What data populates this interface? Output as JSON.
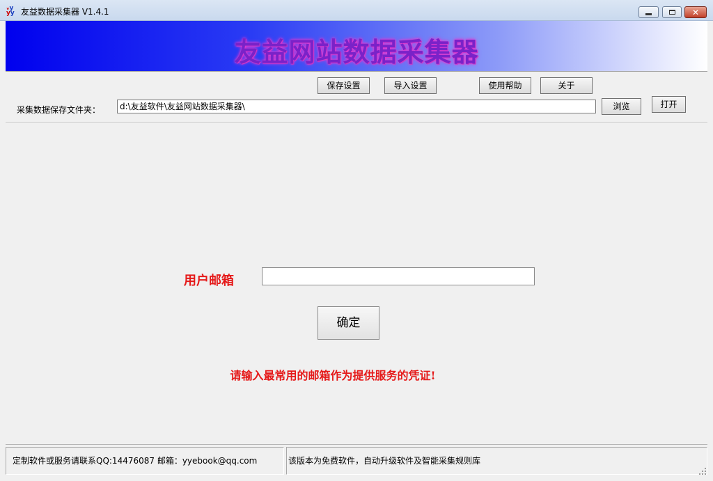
{
  "window": {
    "title": "友益数据采集器 V1.4.1",
    "icon": "app-logo-icon"
  },
  "banner": {
    "title": "友益网站数据采集器"
  },
  "toolbar": {
    "save_settings": "保存设置",
    "import_settings": "导入设置",
    "help": "使用帮助",
    "about": "关于"
  },
  "folder": {
    "label": "采集数据保存文件夹：",
    "value": "d:\\友益软件\\友益网站数据采集器\\",
    "browse": "浏览",
    "open": "打开"
  },
  "form": {
    "email_label": "用户邮箱",
    "email_value": "",
    "ok": "确定",
    "notice": "请输入最常用的邮箱作为提供服务的凭证!"
  },
  "status": {
    "left": "定制软件或服务请联系QQ:14476087 邮箱：yyebook@qq.com",
    "right": "该版本为免费软件，自动升级软件及智能采集规则库"
  },
  "colors": {
    "accent_red": "#e51a1a",
    "banner_blue": "#0000ee",
    "banner_text": "#7a22c8"
  }
}
